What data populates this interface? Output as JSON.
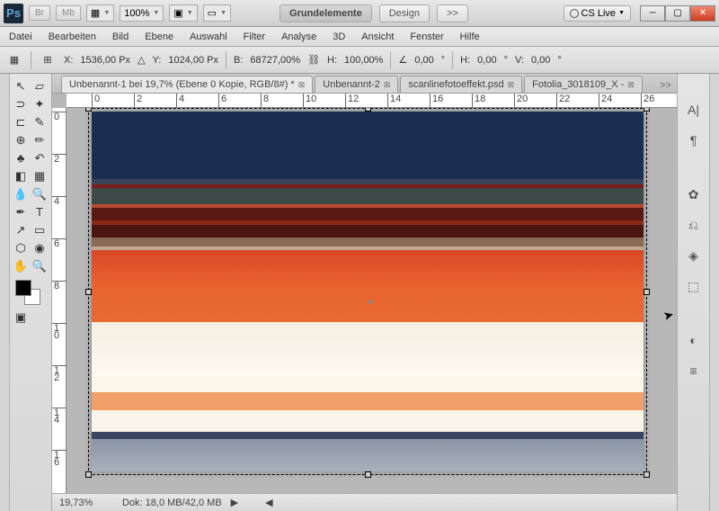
{
  "titlebar": {
    "app": "Ps",
    "br": "Br",
    "mb": "Mb",
    "zoom": "100%",
    "ws_grund": "Grundelemente",
    "ws_design": "Design",
    "arrow": ">>",
    "cslive": "CS Live"
  },
  "menu": {
    "datei": "Datei",
    "bearbeiten": "Bearbeiten",
    "bild": "Bild",
    "ebene": "Ebene",
    "auswahl": "Auswahl",
    "filter": "Filter",
    "analyse": "Analyse",
    "dd": "3D",
    "ansicht": "Ansicht",
    "fenster": "Fenster",
    "hilfe": "Hilfe"
  },
  "opt": {
    "x_lbl": "X:",
    "x": "1536,00 Px",
    "y_lbl": "Y:",
    "y": "1024,00 Px",
    "b_lbl": "B:",
    "b": "68727,00%",
    "h_lbl": "H:",
    "h": "100,00%",
    "ang": "0,00",
    "hh_lbl": "H:",
    "hh": "0,00",
    "v_lbl": "V:",
    "v": "0,00",
    "deg": "°"
  },
  "tabs": [
    {
      "label": "Unbenannt-1 bei 19,7% (Ebene 0 Kopie, RGB/8#) *",
      "active": true
    },
    {
      "label": "Unbenannt-2",
      "active": false
    },
    {
      "label": "scanlinefotoeffekt.psd",
      "active": false
    },
    {
      "label": "Fotolia_3018109_X -",
      "active": false
    }
  ],
  "ruler_h": [
    "0",
    "2",
    "4",
    "6",
    "8",
    "10",
    "12",
    "14",
    "16",
    "18",
    "20",
    "22",
    "24",
    "26"
  ],
  "ruler_v": [
    "0",
    "2",
    "4",
    "6",
    "8",
    "1\n0",
    "1\n2",
    "1\n4",
    "1\n6"
  ],
  "status": {
    "zoom": "19,73%",
    "dok": "Dok: 18,0 MB/42,0 MB"
  }
}
